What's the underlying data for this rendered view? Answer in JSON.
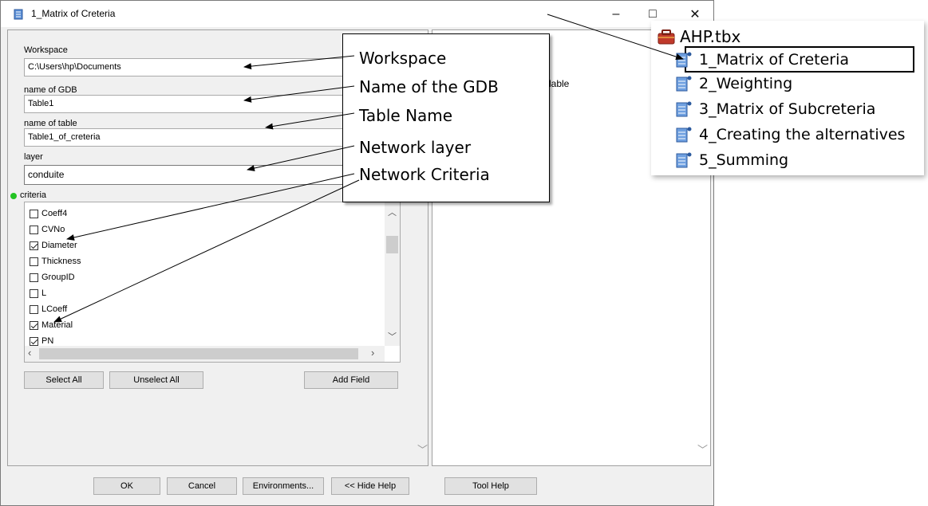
{
  "window": {
    "title": "1_Matrix of Creteria",
    "minimize": "–",
    "maximize": "□",
    "close": "✕"
  },
  "form": {
    "workspace_label": "Workspace",
    "workspace_value": "C:\\Users\\hp\\Documents",
    "gdb_label": "name of GDB",
    "gdb_value": "Table1",
    "table_label": "name of table",
    "table_value": "Table1_of_creteria",
    "layer_label": "layer",
    "layer_value": "conduite",
    "criteria_label": "criteria",
    "criteria_items": [
      {
        "label": "Coeff4",
        "checked": false
      },
      {
        "label": "CVNo",
        "checked": false
      },
      {
        "label": "Diameter",
        "checked": true
      },
      {
        "label": "Thickness",
        "checked": false
      },
      {
        "label": "GroupID",
        "checked": false
      },
      {
        "label": "L",
        "checked": false
      },
      {
        "label": "LCoeff",
        "checked": false
      },
      {
        "label": "Material",
        "checked": true
      },
      {
        "label": "PN",
        "checked": true
      }
    ],
    "select_all": "Select All",
    "unselect_all": "Unselect All",
    "add_field": "Add Field"
  },
  "help_pane": {
    "partial_text": "lable"
  },
  "bottom_buttons": {
    "ok": "OK",
    "cancel": "Cancel",
    "environments": "Environments...",
    "hide_help": "<< Hide Help",
    "tool_help": "Tool Help"
  },
  "callouts": {
    "workspace": "Workspace",
    "gdb": "Name of the GDB",
    "table": "Table Name",
    "layer": "Network layer",
    "criteria": "Network Criteria"
  },
  "toolbox": {
    "name": "AHP.tbx",
    "items": [
      {
        "label": "1_Matrix of Creteria",
        "highlighted": true
      },
      {
        "label": "2_Weighting",
        "highlighted": false
      },
      {
        "label": "3_Matrix of Subcreteria",
        "highlighted": false
      },
      {
        "label": "4_Creating the alternatives",
        "highlighted": false
      },
      {
        "label": "5_Summing",
        "highlighted": false
      }
    ]
  }
}
